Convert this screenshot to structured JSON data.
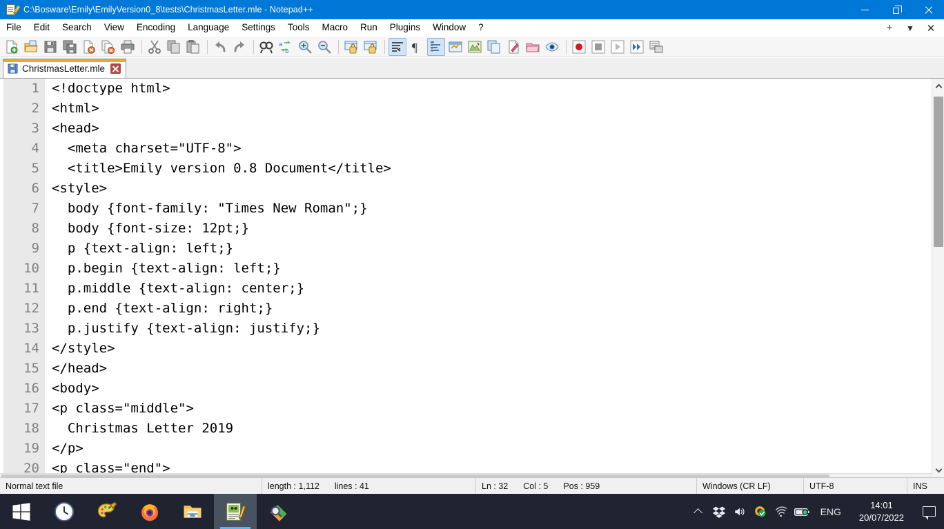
{
  "window": {
    "title": "C:\\Bosware\\Emily\\EmilyVersion0_8\\tests\\ChristmasLetter.mle - Notepad++",
    "icon": "notepadpp-icon",
    "controls": {
      "minimize": "minimize-button",
      "restore": "restore-button",
      "close": "close-button"
    },
    "accent": "#0078D7"
  },
  "menubar": {
    "items": [
      {
        "label": "File"
      },
      {
        "label": "Edit"
      },
      {
        "label": "Search"
      },
      {
        "label": "View"
      },
      {
        "label": "Encoding"
      },
      {
        "label": "Language"
      },
      {
        "label": "Settings"
      },
      {
        "label": "Tools"
      },
      {
        "label": "Macro"
      },
      {
        "label": "Run"
      },
      {
        "label": "Plugins"
      },
      {
        "label": "Window"
      },
      {
        "label": "?"
      }
    ],
    "right": [
      {
        "name": "new-tab-plus",
        "glyph": "+"
      },
      {
        "name": "tab-list-dropdown",
        "glyph": "▼"
      },
      {
        "name": "close-document",
        "glyph": "✕"
      }
    ]
  },
  "toolbar": {
    "groups": [
      [
        "new-file",
        "open-file",
        "save-file",
        "save-all",
        "close-file",
        "close-all",
        "print"
      ],
      [
        "cut",
        "copy",
        "paste",
        "undo",
        "redo"
      ],
      [
        "find",
        "replace",
        "zoom-in",
        "zoom-out"
      ],
      [
        "sync-vertical-scroll",
        "sync-horizontal-scroll"
      ],
      [
        "word-wrap",
        "show-all-characters",
        "show-indent-guide",
        "user-defined-language",
        "document-map",
        "function-list",
        "document-list",
        "folder-as-workspace",
        "monitoring"
      ],
      [
        "start-recording",
        "stop-recording",
        "play-macro",
        "run-macro-multiple",
        "save-current-macro"
      ]
    ]
  },
  "tabs": [
    {
      "label": "ChristmasLetter.mle",
      "active": true,
      "saved": true,
      "icon": "save-floppy-icon",
      "close": "tab-close-icon",
      "active_bar_color": "#f5a623"
    }
  ],
  "editor": {
    "first_visible_line": 1,
    "lines": [
      {
        "n": 1,
        "text": "<!doctype html>"
      },
      {
        "n": 2,
        "text": "<html>"
      },
      {
        "n": 3,
        "text": "<head>"
      },
      {
        "n": 4,
        "text": "  <meta charset=\"UTF-8\">"
      },
      {
        "n": 5,
        "text": "  <title>Emily version 0.8 Document</title>"
      },
      {
        "n": 6,
        "text": "<style>"
      },
      {
        "n": 7,
        "text": "  body {font-family: \"Times New Roman\";}"
      },
      {
        "n": 8,
        "text": "  body {font-size: 12pt;}"
      },
      {
        "n": 9,
        "text": "  p {text-align: left;}"
      },
      {
        "n": 10,
        "text": "  p.begin {text-align: left;}"
      },
      {
        "n": 11,
        "text": "  p.middle {text-align: center;}"
      },
      {
        "n": 12,
        "text": "  p.end {text-align: right;}"
      },
      {
        "n": 13,
        "text": "  p.justify {text-align: justify;}"
      },
      {
        "n": 14,
        "text": "</style>"
      },
      {
        "n": 15,
        "text": "</head>"
      },
      {
        "n": 16,
        "text": "<body>"
      },
      {
        "n": 17,
        "text": "<p class=\"middle\">"
      },
      {
        "n": 18,
        "text": "  Christmas Letter 2019"
      },
      {
        "n": 19,
        "text": "</p>"
      },
      {
        "n": 20,
        "text": "<p class=\"end\">"
      }
    ]
  },
  "statusbar": {
    "file_type": "Normal text file",
    "length_label": "length : 1,112",
    "lines_label": "lines : 41",
    "ln": "Ln : 32",
    "col": "Col : 5",
    "pos": "Pos : 959",
    "eol": "Windows (CR LF)",
    "encoding": "UTF-8",
    "insert_mode": "INS"
  },
  "taskbar": {
    "start": "windows-start-icon",
    "items": [
      {
        "name": "clock-app-icon",
        "active": false,
        "running": false
      },
      {
        "name": "paint-app-icon",
        "active": false,
        "running": false
      },
      {
        "name": "firefox-icon",
        "active": false,
        "running": true
      },
      {
        "name": "file-explorer-icon",
        "active": false,
        "running": true
      },
      {
        "name": "notepadpp-icon",
        "active": true,
        "running": true
      },
      {
        "name": "emily-app-icon",
        "active": false,
        "running": false
      }
    ],
    "tray": [
      {
        "name": "show-hidden-icons-chevron"
      },
      {
        "name": "dropbox-icon"
      },
      {
        "name": "volume-icon"
      },
      {
        "name": "antivirus-shield-icon"
      },
      {
        "name": "wifi-icon"
      },
      {
        "name": "battery-icon"
      }
    ],
    "language": "ENG",
    "time": "14:01",
    "date": "20/07/2022",
    "notifications": "action-center-icon"
  }
}
